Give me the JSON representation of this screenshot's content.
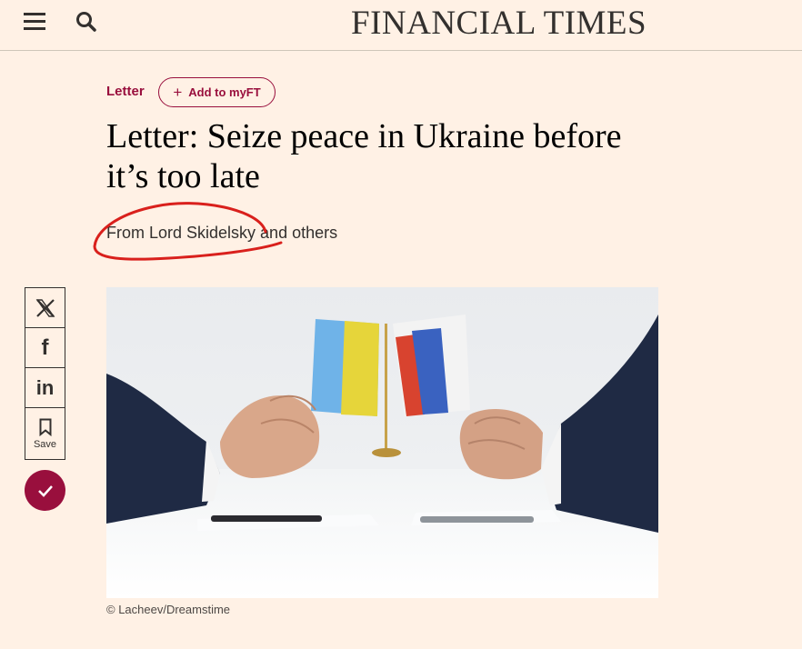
{
  "header": {
    "logo": "FINANCIAL TIMES",
    "menu_icon": "hamburger-menu-icon",
    "search_icon": "search-icon"
  },
  "article": {
    "topic": "Letter",
    "myft_label": "Add to myFT",
    "headline": "Letter: Seize peace in Ukraine before it’s too late",
    "standfirst": "From Lord Skidelsky and others",
    "image_caption": "© Lacheev/Dreamstime"
  },
  "share": {
    "save_label": "Save",
    "icons": [
      "x-icon",
      "facebook-icon",
      "linkedin-icon",
      "bookmark-icon",
      "checkmark-icon"
    ]
  },
  "colors": {
    "background": "#fff1e5",
    "claret": "#990f3d",
    "text": "#33302e",
    "annotation": "#d9201c"
  }
}
